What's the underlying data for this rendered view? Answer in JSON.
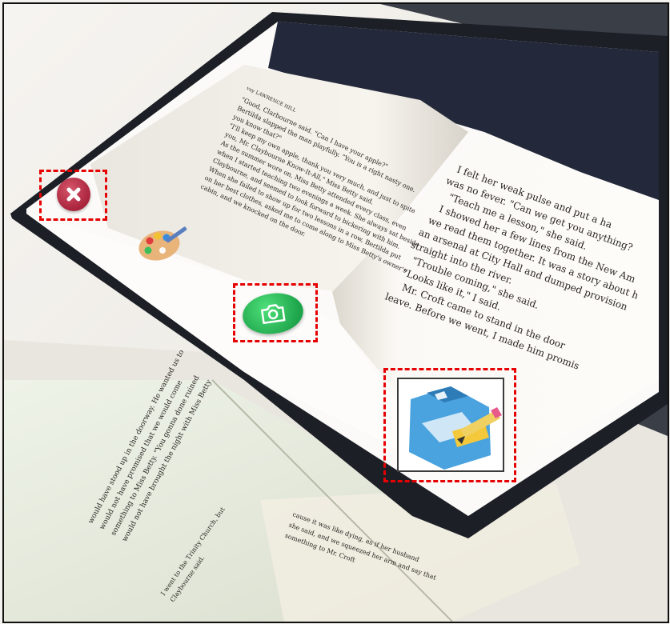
{
  "book": {
    "left_page": {
      "header": "vuy LAWRENCE HILL",
      "lines": [
        "\"Good, Clarbourne said. \"Can I have your apple?\"",
        "Bertilda slapped the man playfully. \"You is a right nasty one.",
        "you know that?\"",
        "\"I'll keep my own apple, thank you very much, and just to spite",
        "you, Mr. Claybourne Know-It-All,\" Miss Betty said.",
        "As the summer wore on, Miss Betty attended every class, even",
        "when I started teaching two evenings a week. She always sat beside",
        "Claybourne, and seemed to look forward to bickering with him.",
        "When she failed to show up for two lessons in a row, Bertilda put",
        "on her best clothes, asked me to come along to Miss Betty's owner's",
        "cabin, and we knocked on the door."
      ]
    },
    "right_page": {
      "lines": [
        "I felt her weak pulse and put a ha",
        "was no fever. \"Can we get you anything?",
        "\"Teach me a lesson,\" she said.",
        "I showed her a few lines from the New Am",
        "we read them together. It was a story about h",
        "an arsenal at City Hall and dumped provision",
        "straight into the river.",
        "\"Trouble coming,\" she said.",
        "\"Looks like it,\" I said.",
        "Mr. Croft came to stand in the door",
        "leave. Before we went, I made him promis"
      ]
    },
    "lower_book": {
      "lines": [
        "would have stood up in the doorway. He wanted us to",
        "would not have promised that we would come",
        "something to Miss Betty. \"You gonna done ruined",
        "would not have brought the night with Miss Betty",
        "cause it was like dying, as if her husband",
        "she said, and we squeezed her arm and say that",
        "something to Mr. Croft",
        "I went to the Trinity Church, but",
        "Claybourne said."
      ]
    }
  },
  "toolbar": {
    "close": "close-icon",
    "palette": "palette-icon",
    "camera": "camera-icon",
    "save": "save-icon"
  },
  "colors": {
    "highlight": "#e60000",
    "close_button": "#b5304a",
    "camera_button": "#22b14c",
    "tablet_bezel": "#1c1f26"
  }
}
